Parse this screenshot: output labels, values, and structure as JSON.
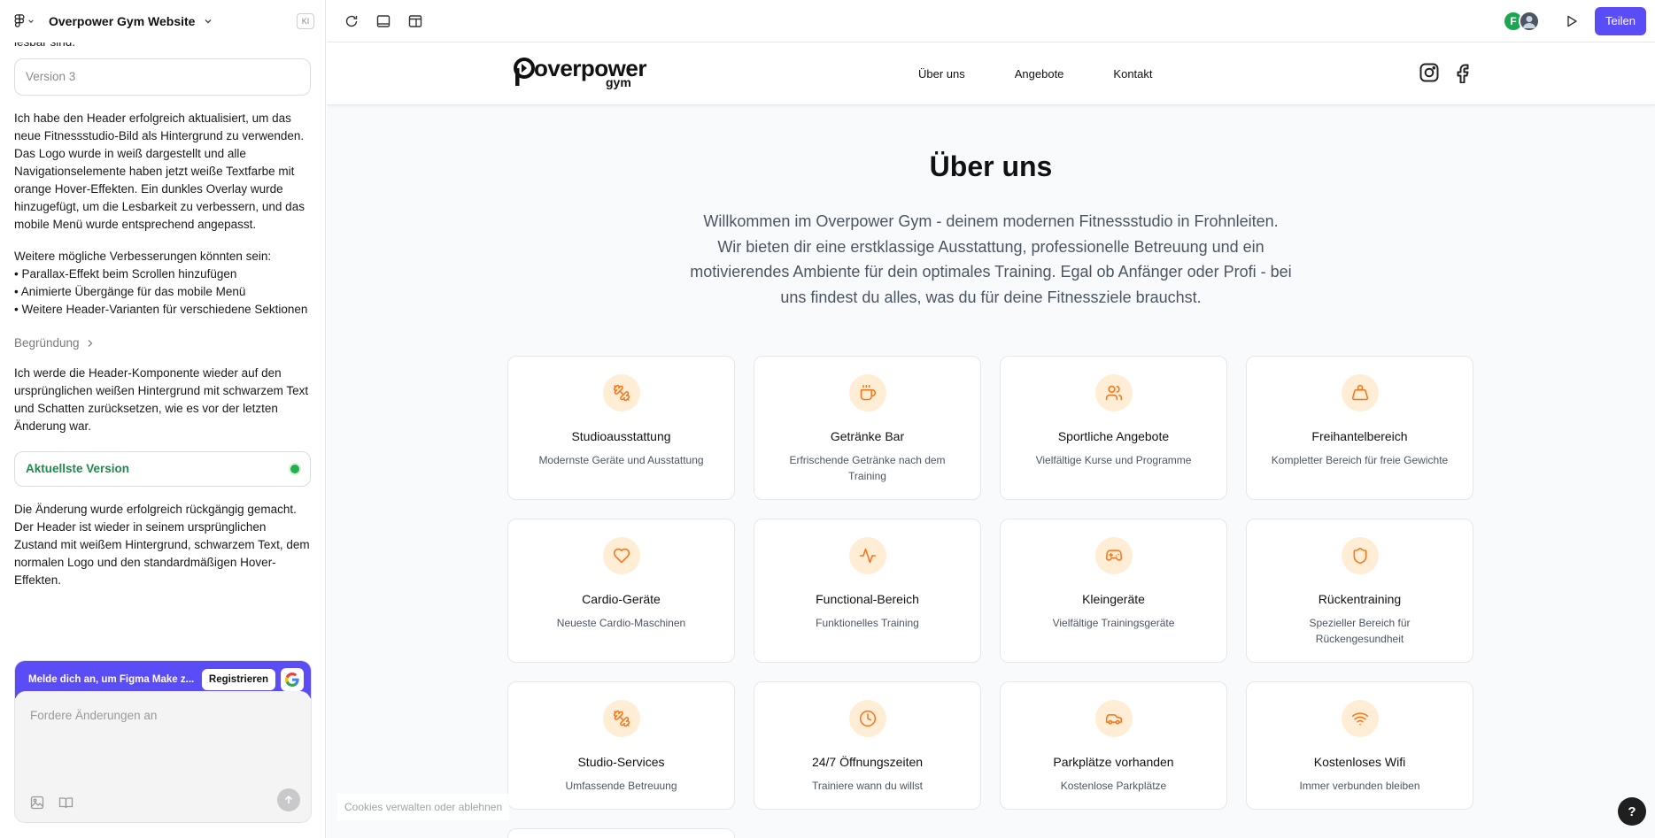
{
  "editor": {
    "project_title": "Overpower Gym Website",
    "ki_badge": "KI",
    "chat": {
      "truncated_top": "lesbar sind.",
      "version_label": "Version 3",
      "message_1": "Ich habe den Header erfolgreich aktualisiert, um das neue Fitnessstudio-Bild als Hintergrund zu verwenden. Das Logo wurde in weiß dargestellt und alle Navigationselemente haben jetzt weiße Textfarbe mit orange Hover-Effekten. Ein dunkles Overlay wurde hinzugefügt, um die Lesbarkeit zu verbessern, und das mobile Menü wurde entsprechend angepasst.",
      "message_2": "Weitere mögliche Verbesserungen könnten sein:\n• Parallax-Effekt beim Scrollen hinzufügen\n• Animierte Übergänge für das mobile Menü\n• Weitere Header-Varianten für verschiedene Sektionen",
      "reasoning_label": "Begründung",
      "message_3": "Ich werde die Header-Komponente wieder auf den ursprünglichen weißen Hintergrund mit schwarzem Text und Schatten zurücksetzen, wie es vor der letzten Änderung war.",
      "latest_version_label": "Aktuellste Version",
      "message_4": "Die Änderung wurde erfolgreich rückgängig gemacht. Der Header ist wieder in seinem ursprünglichen Zustand mit weißem Hintergrund, schwarzem Text, dem normalen Logo und den standardmäßigen Hover-Effekten."
    },
    "signup_bar": {
      "text": "Melde dich an, um Figma Make z...",
      "register_label": "Registrieren"
    },
    "composer_placeholder": "Fordere Änderungen an",
    "toolbar": {
      "avatar_initial": "F",
      "share_label": "Teilen"
    }
  },
  "site": {
    "logo_main": "overpower",
    "logo_sub": "gym",
    "nav": [
      "Über uns",
      "Angebote",
      "Kontakt"
    ],
    "about_title": "Über uns",
    "about_text": "Willkommen im Overpower Gym - deinem modernen Fitnessstudio in Frohnleiten. Wir bieten dir eine erstklassige Ausstattung, professionelle Betreuung und ein motivierendes Ambiente für dein optimales Training. Egal ob Anfänger oder Profi - bei uns findest du alles, was du für deine Fitnessziele brauchst.",
    "features": [
      {
        "icon": "dumbbell-icon",
        "title": "Studioausstattung",
        "desc": "Modernste Geräte und Ausstattung"
      },
      {
        "icon": "coffee-icon",
        "title": "Getränke Bar",
        "desc": "Erfrischende Getränke nach dem Training"
      },
      {
        "icon": "users-icon",
        "title": "Sportliche Angebote",
        "desc": "Vielfältige Kurse und Programme"
      },
      {
        "icon": "weight-icon",
        "title": "Freihantelbereich",
        "desc": "Kompletter Bereich für freie Gewichte"
      },
      {
        "icon": "heart-icon",
        "title": "Cardio-Geräte",
        "desc": "Neueste Cardio-Maschinen"
      },
      {
        "icon": "activity-icon",
        "title": "Functional-Bereich",
        "desc": "Funktionelles Training"
      },
      {
        "icon": "gamepad-icon",
        "title": "Kleingeräte",
        "desc": "Vielfältige Trainingsgeräte"
      },
      {
        "icon": "shield-icon",
        "title": "Rückentraining",
        "desc": "Spezieller Bereich für Rückengesundheit"
      },
      {
        "icon": "dumbbell-icon",
        "title": "Studio-Services",
        "desc": "Umfassende Betreuung"
      },
      {
        "icon": "clock-icon",
        "title": "24/7 Öffnungszeiten",
        "desc": "Trainiere wann du willst"
      },
      {
        "icon": "car-icon",
        "title": "Parkplätze vorhanden",
        "desc": "Kostenlose Parkplätze"
      },
      {
        "icon": "wifi-icon",
        "title": "Kostenloses Wifi",
        "desc": "Immer verbunden bleiben"
      }
    ],
    "cookie_notice": "Cookies verwalten oder ablehnen",
    "help_label": "?"
  },
  "colors": {
    "accent_orange": "#f97316",
    "icon_bg": "#ffedd5",
    "figma_purple": "#5b4df5",
    "status_green": "#22b04b"
  }
}
